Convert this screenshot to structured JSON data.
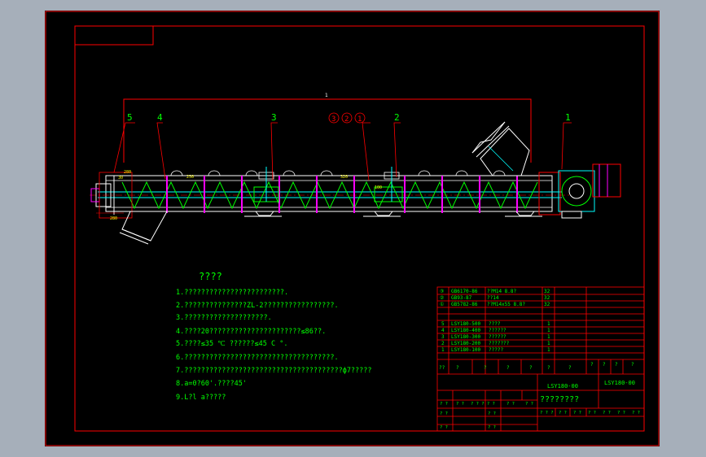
{
  "colors": {
    "viewport": "#a6afba",
    "sheet": "#000000",
    "frame": "#ff0000",
    "text": "#00ff00",
    "machine": "#ffffff",
    "accent": "#ff00ff",
    "dim": "#ffff00",
    "cyan": "#00ffff",
    "motor": "#ff0000"
  },
  "drawing": {
    "balloons": [
      "5",
      "4",
      "3",
      "1",
      "2",
      "1"
    ],
    "circled": [
      "3",
      "2",
      "1"
    ],
    "dims": [
      "1",
      "280",
      "30",
      "250",
      "100",
      "320",
      "280"
    ]
  },
  "notes": {
    "title": "????",
    "items": [
      "1.????????????????????????.",
      "2.???????????????ZL-2?????????????????.",
      "3.????????????????????.",
      "4.????20??????????????????????≤86??.",
      "5.????≤35 ℃ ??????≤45 C °.",
      "6.????????????????????????????????????.",
      "7.??????????????????????????????????????ф7?????",
      "8.a=0?60'.????45'",
      "9.L?l a?????"
    ]
  },
  "bom": {
    "std_rows": [
      {
        "no": "③",
        "code": "GB6170-86",
        "name": "??M14 8.8?",
        "qty": "32"
      },
      {
        "no": "②",
        "code": "GB93-87",
        "name": "??14",
        "qty": "32"
      },
      {
        "no": "①",
        "code": "GB5782-86",
        "name": "??M14x55 8.8?",
        "qty": "32"
      }
    ],
    "part_rows": [
      {
        "no": "5",
        "code": "LSY180-500",
        "name": "????",
        "qty": "1"
      },
      {
        "no": "4",
        "code": "LSY180-400",
        "name": "??????",
        "qty": "1"
      },
      {
        "no": "3",
        "code": "LSY180-300",
        "name": "??????",
        "qty": "1"
      },
      {
        "no": "2",
        "code": "LSY180-200",
        "name": "???????",
        "qty": "1"
      },
      {
        "no": "1",
        "code": "LSY180-100",
        "name": "?????",
        "qty": "1"
      }
    ],
    "header": [
      "??",
      "?",
      "?",
      "?",
      "?",
      "?",
      "?"
    ],
    "header_right": [
      "?",
      "?",
      "?",
      "?"
    ]
  },
  "title_block": {
    "model": "LSY180-00",
    "drawing_no": "LSY180-00",
    "name": "????????",
    "row_a": [
      "? ?",
      "? ?",
      "? ? ? ? ?",
      "? ?",
      "? ?"
    ],
    "row_b": [
      "? ?",
      "? ?"
    ],
    "row_c": [
      "? ?",
      "? ?"
    ],
    "row_d": [
      "? ? ?",
      "? ?",
      "? ?",
      "? ?",
      "? ?",
      "? ?",
      "? ?"
    ]
  }
}
